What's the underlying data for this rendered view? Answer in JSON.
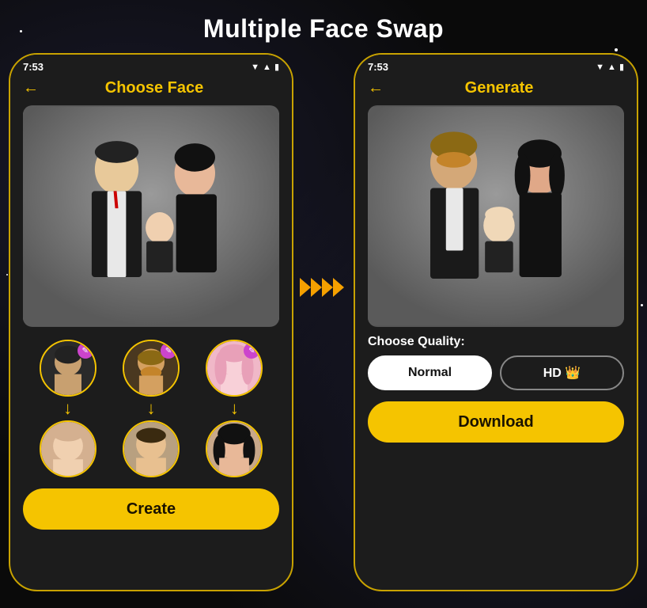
{
  "page": {
    "title": "Multiple Face Swap",
    "background_color": "#0a0a0a"
  },
  "left_phone": {
    "status_time": "7:53",
    "back_label": "←",
    "header_title": "Choose Face",
    "face_pairs": [
      {
        "id": 1,
        "source_face": "person-1-icon",
        "target_face": "baby-icon",
        "has_edit": true
      },
      {
        "id": 2,
        "source_face": "person-2-icon",
        "target_face": "man-icon",
        "has_edit": true
      },
      {
        "id": 3,
        "source_face": "person-3-icon",
        "target_face": "woman-icon",
        "has_edit": true
      }
    ],
    "create_button": "Create"
  },
  "arrow": {
    "symbol": "❯❯❯❯"
  },
  "right_phone": {
    "status_time": "7:53",
    "back_label": "←",
    "header_title": "Generate",
    "quality_label": "Choose Quality:",
    "quality_options": [
      {
        "label": "Normal",
        "active": true
      },
      {
        "label": "HD 👑",
        "active": false
      }
    ],
    "download_button": "Download"
  }
}
